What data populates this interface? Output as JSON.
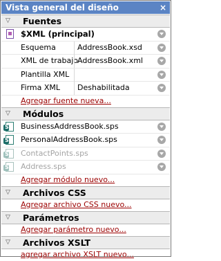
{
  "title": "Vista general del diseño",
  "close_label": "×",
  "sections": {
    "fuentes": {
      "label": "Fuentes",
      "xml_label": "$XML (principal)",
      "fields": [
        {
          "label": "Esquema",
          "value": "AddressBook.xsd"
        },
        {
          "label": "XML de trabajo",
          "value": "AddressBook.xml"
        },
        {
          "label": "Plantilla XML",
          "value": ""
        },
        {
          "label": "Firma XML",
          "value": "Deshabilitada"
        }
      ],
      "add": "Agregar fuente nueva..."
    },
    "modulos": {
      "label": "Módulos",
      "items": [
        {
          "label": "BusinessAddressBook.sps"
        },
        {
          "label": "PersonalAddressBook.sps"
        },
        {
          "label": "ContactPoints.sps"
        },
        {
          "label": "Address.sps"
        }
      ],
      "add": "Agregar módulo nuevo..."
    },
    "css": {
      "label": "Archivos CSS",
      "add": "Agregar archivo CSS nuevo..."
    },
    "parametros": {
      "label": "Parámetros",
      "add": "Agregar parámetro nuevo..."
    },
    "xslt": {
      "label": "Archivos XSLT",
      "add": "agregar archivo XSLT nuevo..."
    }
  },
  "icons": {
    "section_toggle": "triangle-down-icon",
    "dropdown": "chevron-down-icon",
    "sps_file": "sps-file-icon",
    "xml_source": "xml-source-icon"
  }
}
